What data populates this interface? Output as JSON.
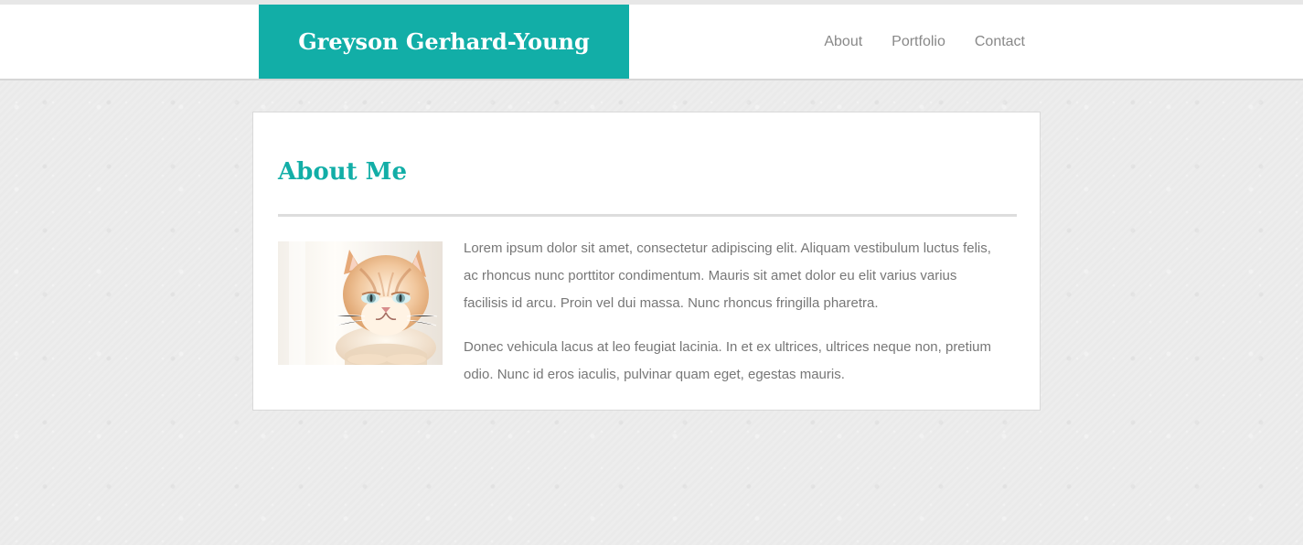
{
  "header": {
    "brand": "Greyson Gerhard-Young",
    "nav": [
      {
        "label": "About"
      },
      {
        "label": "Portfolio"
      },
      {
        "label": "Contact"
      }
    ]
  },
  "main": {
    "title": "About Me",
    "image": {
      "alt": "cat photo"
    },
    "paragraphs": [
      "Lorem ipsum dolor sit amet, consectetur adipiscing elit. Aliquam vestibulum luctus felis, ac rhoncus nunc porttitor condimentum. Mauris sit amet dolor eu elit varius varius facilisis id arcu. Proin vel dui massa. Nunc rhoncus fringilla pharetra.",
      "Donec vehicula lacus at leo feugiat lacinia. In et ex ultrices, ultrices neque non, pretium odio. Nunc id eros iaculis, pulvinar quam eget, egestas mauris."
    ]
  },
  "colors": {
    "accent": "#12aea7",
    "text": "#777777",
    "nav_text": "#888888",
    "background": "#eaeaea"
  }
}
